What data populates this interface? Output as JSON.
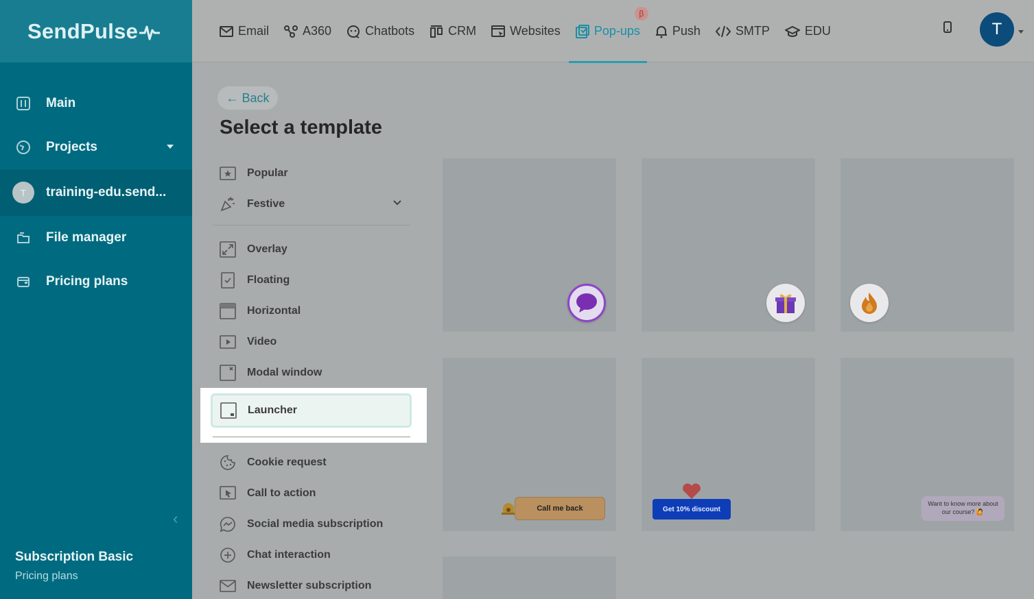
{
  "brand": {
    "logo_text": "SendPulse"
  },
  "sidebar": {
    "items": [
      {
        "label": "Main",
        "icon": "sliders-icon"
      },
      {
        "label": "Projects",
        "icon": "globe-icon"
      },
      {
        "label": "training-edu.send...",
        "avatar": "T"
      },
      {
        "label": "File manager",
        "icon": "folder-icon"
      },
      {
        "label": "Pricing plans",
        "icon": "wallet-icon"
      }
    ],
    "subscription_title": "Subscription Basic",
    "subscription_link": "Pricing plans"
  },
  "topnav": {
    "items": [
      {
        "label": "Email",
        "icon": "envelope-icon"
      },
      {
        "label": "A360",
        "icon": "flow-icon"
      },
      {
        "label": "Chatbots",
        "icon": "chat-icon"
      },
      {
        "label": "CRM",
        "icon": "kanban-icon"
      },
      {
        "label": "Websites",
        "icon": "website-icon"
      },
      {
        "label": "Pop-ups",
        "icon": "popup-icon",
        "active": true,
        "badge": "β"
      },
      {
        "label": "Push",
        "icon": "bell-icon"
      },
      {
        "label": "SMTP",
        "icon": "code-icon"
      },
      {
        "label": "EDU",
        "icon": "graduation-icon"
      }
    ],
    "user_avatar": "T"
  },
  "main": {
    "back_label": "← Back",
    "title": "Select a template",
    "categories_top": [
      {
        "label": "Popular",
        "icon": "star-icon"
      },
      {
        "label": "Festive",
        "icon": "confetti-icon"
      }
    ],
    "categories_types": [
      {
        "label": "Overlay",
        "icon": "expand-icon"
      },
      {
        "label": "Floating",
        "icon": "check-square-icon"
      },
      {
        "label": "Horizontal",
        "icon": "horizontal-icon"
      },
      {
        "label": "Video",
        "icon": "play-icon"
      },
      {
        "label": "Modal window",
        "icon": "close-square-icon"
      },
      {
        "label": "Launcher",
        "icon": "launcher-icon",
        "selected": true
      }
    ],
    "categories_goals": [
      {
        "label": "Cookie request",
        "icon": "cookie-icon"
      },
      {
        "label": "Call to action",
        "icon": "cursor-icon"
      },
      {
        "label": "Social media subscription",
        "icon": "messenger-icon"
      },
      {
        "label": "Chat interaction",
        "icon": "plus-circle-icon"
      },
      {
        "label": "Newsletter subscription",
        "icon": "envelope-icon"
      }
    ],
    "cards": {
      "call_me_back": "Call me back",
      "discount": "Get 10% discount",
      "know_more": "Want to know more about our course? 🙋"
    }
  }
}
